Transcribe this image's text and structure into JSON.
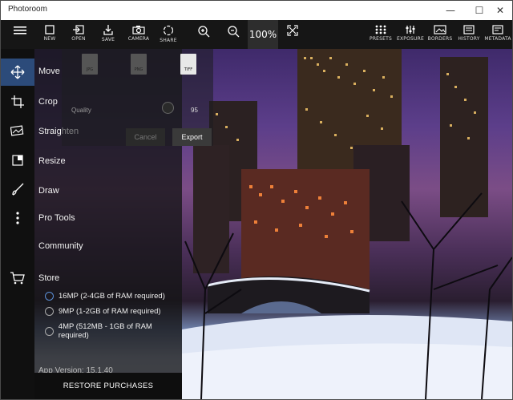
{
  "window": {
    "title": "Photoroom",
    "controls": [
      "—",
      "☐",
      "✕"
    ]
  },
  "toolbar": {
    "left_items": [
      {
        "id": "menu",
        "label": ""
      },
      {
        "id": "new",
        "label": "NEW"
      },
      {
        "id": "open",
        "label": "OPEN"
      },
      {
        "id": "save",
        "label": "SAVE"
      },
      {
        "id": "camera",
        "label": "CAMERA"
      },
      {
        "id": "share",
        "label": "SHARE"
      }
    ],
    "zoom_level": "100%",
    "right_items": [
      {
        "id": "presets",
        "label": "PRESETS"
      },
      {
        "id": "exposure",
        "label": "EXPOSURE"
      },
      {
        "id": "borders",
        "label": "BORDERS"
      },
      {
        "id": "history",
        "label": "HISTORY"
      },
      {
        "id": "metadata",
        "label": "METADATA"
      }
    ]
  },
  "save_panel": {
    "formats": [
      "JPG",
      "PNG",
      "TIFF"
    ],
    "selected_format": "TIFF",
    "quality_label": "Quality",
    "quality_value": "95",
    "cancel_label": "Cancel",
    "export_label": "Export"
  },
  "menu": {
    "items": [
      {
        "label": "Move",
        "icon": "move-icon"
      },
      {
        "label": "Crop",
        "icon": "crop-icon"
      },
      {
        "label": "Straighten",
        "icon": "straighten-icon"
      },
      {
        "label": "Resize",
        "icon": "resize-icon"
      },
      {
        "label": "Draw",
        "icon": "brush-icon"
      },
      {
        "label": "Pro Tools",
        "icon": "more-icon"
      },
      {
        "label": "Community",
        "icon": ""
      },
      {
        "label": "Store",
        "icon": "cart-icon"
      }
    ],
    "resolutions": [
      {
        "label": "16MP (2-4GB of RAM required)",
        "selected": true
      },
      {
        "label": "9MP (1-2GB of RAM required)",
        "selected": false
      },
      {
        "label": "4MP (512MB - 1GB of RAM required)",
        "selected": false
      }
    ],
    "version": "App Version: 15.1.40",
    "restore_label": "RESTORE PURCHASES"
  },
  "colors": {
    "accent": "#5b8fd6",
    "active_rail": "#2c4b7a"
  }
}
